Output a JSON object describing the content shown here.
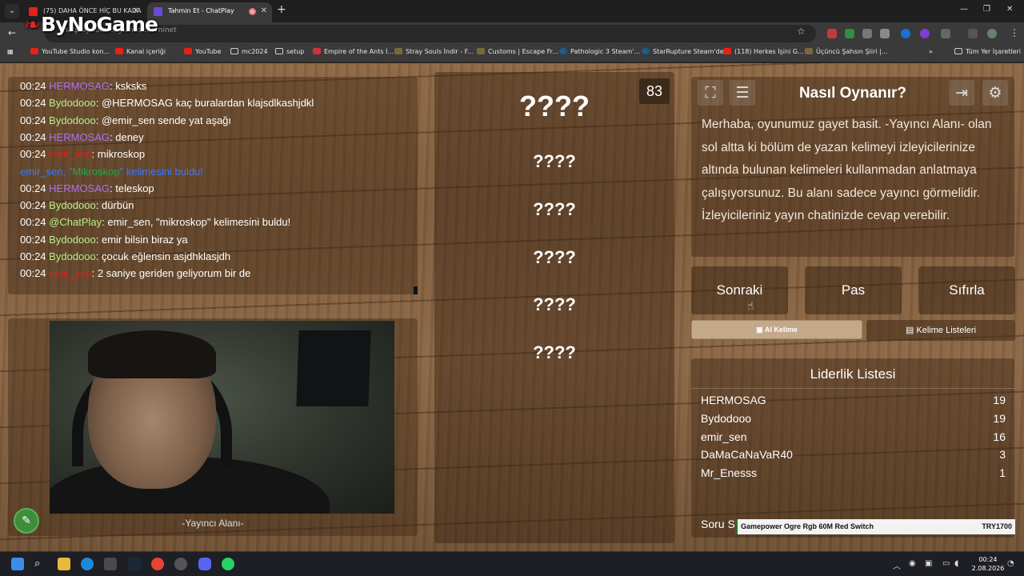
{
  "browser": {
    "tabs": [
      {
        "title": "(75) DAHA ÖNCE HİÇ BU KADA"
      },
      {
        "title": "Tahmin Et - ChatPlay"
      }
    ],
    "url": "chatplay.com.tr/games/tahminet",
    "watermark": "ByNoGame",
    "bookmarks": [
      {
        "label": "YouTube Studio kon...",
        "icon": "youtube-icon"
      },
      {
        "label": "Kanal içeriği",
        "icon": "youtube-icon"
      },
      {
        "label": "YouTube",
        "icon": "youtube-icon"
      },
      {
        "label": "mc2024",
        "icon": "folder-icon"
      },
      {
        "label": "setup",
        "icon": "folder-icon"
      },
      {
        "label": "Empire of the Ants İ...",
        "icon": "site-icon"
      },
      {
        "label": "Stray Souls İndir - F...",
        "icon": "site-icon"
      },
      {
        "label": "Customs | Escape Fr...",
        "icon": "site-icon"
      },
      {
        "label": "Pathologic 3 Steam'...",
        "icon": "steam-icon"
      },
      {
        "label": "StarRupture Steam'de",
        "icon": "steam-icon"
      },
      {
        "label": "(118) Herkes İşini G...",
        "icon": "youtube-icon"
      },
      {
        "label": "Üçüncü Şahsın Şiiri |...",
        "icon": "site-icon"
      }
    ],
    "all_bookmarks": "Tüm Yer İşaretleri"
  },
  "chat": {
    "messages": [
      {
        "time": "00:24",
        "user": "HERMOSAG",
        "text": ": ksksks",
        "cls": "u-herm"
      },
      {
        "time": "00:24",
        "user": "Bydodooo",
        "text": ": @HERMOSAG kaç buralardan klajsdlkashjdkl",
        "cls": "u-byd"
      },
      {
        "time": "00:24",
        "user": "Bydodooo",
        "text": ": @emir_sen sende yat aşağı",
        "cls": "u-byd"
      },
      {
        "time": "00:24",
        "user": "HERMOSAG",
        "text": ": deney",
        "cls": "u-herm"
      },
      {
        "time": "00:24",
        "user": "emir_sen",
        "text": ": mikroskop",
        "cls": "u-emir"
      },
      {
        "notice_pre": "emir_sen, \"",
        "notice_kw": "Mikroskop",
        "notice_post": "\" kelimesini buldu!"
      },
      {
        "time": "00:24",
        "user": "HERMOSAG",
        "text": ": teleskop",
        "cls": "u-herm"
      },
      {
        "time": "00:24",
        "user": "Bydodooo",
        "text": ": dürbün",
        "cls": "u-byd"
      },
      {
        "time": "00:24",
        "user": "@ChatPlay",
        "text": ": emir_sen, \"mikroskop\" kelimesini buldu!",
        "cls": "u-byd"
      },
      {
        "time": "00:24",
        "user": "Bydodooo",
        "text": ": emir bilsin biraz ya",
        "cls": "u-byd"
      },
      {
        "time": "00:24",
        "user": "Bydodooo",
        "text": ": çocuk eğlensin asjdhklasjdh",
        "cls": "u-byd"
      },
      {
        "time": "00:24",
        "user": "emir_sen",
        "text": ": 2 saniye geriden geliyorum bir de",
        "cls": "u-emir"
      }
    ]
  },
  "streamer": {
    "label": "-Yayıncı Alanı-"
  },
  "game": {
    "counter": "83",
    "words": [
      "????",
      "????",
      "????",
      "????",
      "????",
      "????"
    ]
  },
  "howto": {
    "title": "Nasıl Oynanır?",
    "body": "Merhaba, oyunumuz gayet basit. -Yayıncı Alanı- olan sol altta ki bölüm de yazan kelimeyi izleyicilerinize altında bulunan kelimeleri kullanmadan anlatmaya çalışıyorsunuz. Bu alanı sadece yayıncı görmelidir. İzleyicileriniz yayın chatinizde cevap verebilir."
  },
  "controls": {
    "next": "Sonraki",
    "pass": "Pas",
    "reset": "Sıfırla",
    "ai_word": "AI Kelime",
    "word_lists": "Kelime Listeleri"
  },
  "leaderboard": {
    "title": "Liderlik Listesi",
    "rows": [
      {
        "name": "HERMOSAG",
        "score": "19"
      },
      {
        "name": "Bydodooo",
        "score": "19"
      },
      {
        "name": "emir_sen",
        "score": "16"
      },
      {
        "name": "DaMaCaNaVaR40",
        "score": "3"
      },
      {
        "name": "Mr_Enesss",
        "score": "1"
      }
    ],
    "soru_label": "Soru S"
  },
  "promo": {
    "product": "Gamepower Ogre Rgb 60M Red Switch",
    "price": "TRY1700"
  },
  "taskbar": {
    "time": "00:24",
    "date": "2.08.2026"
  }
}
